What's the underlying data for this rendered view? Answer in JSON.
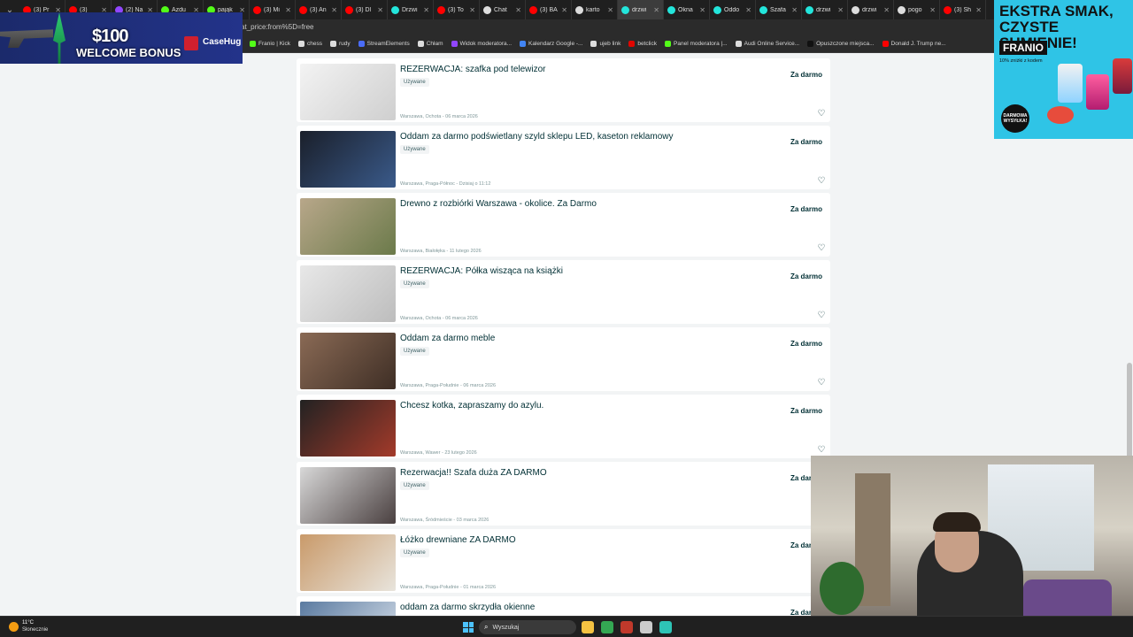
{
  "browser": {
    "tabs": [
      {
        "label": "(3) Pr",
        "color": "#ff0000"
      },
      {
        "label": "(3) ",
        "color": "#ff0000"
      },
      {
        "label": "(2) Na",
        "color": "#9146ff"
      },
      {
        "label": "Azdu",
        "color": "#53fc18"
      },
      {
        "label": "pająk",
        "color": "#53fc18"
      },
      {
        "label": "(3) Mi",
        "color": "#ff0000"
      },
      {
        "label": "(3) An",
        "color": "#ff0000"
      },
      {
        "label": "(3) Dl",
        "color": "#ff0000"
      },
      {
        "label": "Drzwi",
        "color": "#23e5db"
      },
      {
        "label": "(3) To",
        "color": "#ff0000"
      },
      {
        "label": "Chat",
        "color": "#dddddd"
      },
      {
        "label": "(3) BA",
        "color": "#ff0000"
      },
      {
        "label": "karto",
        "color": "#dddddd"
      },
      {
        "label": "drzwi",
        "color": "#23e5db",
        "active": true
      },
      {
        "label": "Okna",
        "color": "#23e5db"
      },
      {
        "label": "Oddo",
        "color": "#23e5db"
      },
      {
        "label": "Szafa",
        "color": "#23e5db"
      },
      {
        "label": "drzwi",
        "color": "#23e5db"
      },
      {
        "label": "drzwi",
        "color": "#dddddd"
      },
      {
        "label": "pogo",
        "color": "#dddddd"
      },
      {
        "label": "(3) Sh",
        "color": "#ff0000"
      }
    ],
    "url_fragment": "at_price:from%5D=free",
    "bookmarks": [
      {
        "label": "Franio | Kick",
        "color": "#53fc18"
      },
      {
        "label": "chess",
        "color": "#dddddd"
      },
      {
        "label": "rudy",
        "color": "#dddddd"
      },
      {
        "label": "StreamElements",
        "color": "#4a6cf7"
      },
      {
        "label": "Chłam",
        "color": "#dddddd"
      },
      {
        "label": "Widok moderatora...",
        "color": "#9146ff"
      },
      {
        "label": "Kalendarz Google -...",
        "color": "#4285f4"
      },
      {
        "label": "ujeb link",
        "color": "#dddddd"
      },
      {
        "label": "betclick",
        "color": "#e10600"
      },
      {
        "label": "Panel moderatora |...",
        "color": "#53fc18"
      },
      {
        "label": "Audi Online Service...",
        "color": "#dddddd"
      },
      {
        "label": "Opuszczone miejsca...",
        "color": "#111111"
      },
      {
        "label": "Donald J. Trump ne...",
        "color": "#ff0000"
      }
    ]
  },
  "promo_left": {
    "amount": "$100",
    "welcome": "WELCOME BONUS",
    "brand": "CaseHug"
  },
  "promo_right": {
    "headline": "EKSTRA SMAK, CZYSTE SUMIENIE!",
    "brand": "FRANIO",
    "subline": "10% zniżki z kodem",
    "badge": "DARMOWA WYSYŁKA!"
  },
  "listings": [
    {
      "title": "REZERWACJA: szafka pod telewizor",
      "condition": "Używane",
      "location_date": "Warszawa, Ochota - 06 marca 2026",
      "price": "Za darmo",
      "thumb": [
        "#f3f3f3",
        "#cfcfcf"
      ]
    },
    {
      "title": "Oddam za darmo podświetlany szyld sklepu LED, kaseton reklamowy",
      "condition": "Używane",
      "location_date": "Warszawa, Praga-Północ - Dzisiaj o 11:12",
      "price": "Za darmo",
      "thumb": [
        "#1a1f2a",
        "#3a5a8a"
      ]
    },
    {
      "title": "Drewno z rozbiórki Warszawa - okolice. Za Darmo",
      "condition": "",
      "location_date": "Warszawa, Białołęka - 11 lutego 2026",
      "price": "Za darmo",
      "thumb": [
        "#b8a78a",
        "#6b7a4a"
      ]
    },
    {
      "title": "REZERWACJA: Półka wisząca na książki",
      "condition": "Używane",
      "location_date": "Warszawa, Ochota - 06 marca 2026",
      "price": "Za darmo",
      "thumb": [
        "#e8e8e8",
        "#bdbdbd"
      ]
    },
    {
      "title": "Oddam za darmo meble",
      "condition": "Używane",
      "location_date": "Warszawa, Praga-Południe - 06 marca 2026",
      "price": "Za darmo",
      "thumb": [
        "#8a6a55",
        "#3e2e25"
      ]
    },
    {
      "title": "Chcesz kotka, zapraszamy do azylu.",
      "condition": "",
      "location_date": "Warszawa, Wawer - 23 lutego 2026",
      "price": "Za darmo",
      "thumb": [
        "#222222",
        "#a33a2a"
      ]
    },
    {
      "title": "Rezerwacja!! Szafa duża ZA DARMO",
      "condition": "Używane",
      "location_date": "Warszawa, Śródmieście - 03 marca 2026",
      "price": "Za darmo",
      "thumb": [
        "#d8d8d8",
        "#4a4040"
      ]
    },
    {
      "title": "Łóżko drewniane ZA DARMO",
      "condition": "Używane",
      "location_date": "Warszawa, Praga-Południe - 01 marca 2026",
      "price": "Za darmo",
      "thumb": [
        "#c99a6a",
        "#e8e4dc"
      ]
    },
    {
      "title": "oddam za darmo skrzydła okienne",
      "condition": "",
      "location_date": "",
      "price": "Za darmo",
      "thumb": [
        "#5a7aa0",
        "#dfe6ee"
      ]
    }
  ],
  "taskbar": {
    "weather_temp": "11°C",
    "weather_desc": "Słonecznie",
    "search_placeholder": "Wyszukaj",
    "apps": [
      {
        "name": "file-explorer-icon",
        "color": "#f5c242"
      },
      {
        "name": "chrome-icon",
        "color": "#34a853"
      },
      {
        "name": "app-red-icon",
        "color": "#c0392b"
      },
      {
        "name": "app-gray-icon",
        "color": "#cccccc"
      },
      {
        "name": "app-doc-icon",
        "color": "#2ec4b6"
      }
    ]
  }
}
